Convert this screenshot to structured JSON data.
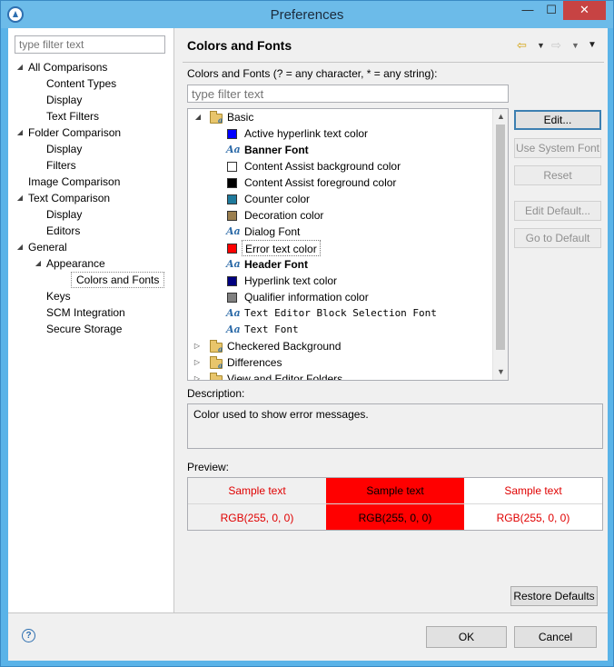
{
  "window": {
    "title": "Preferences"
  },
  "titlebar": {
    "minimize_glyph": "—",
    "maximize_glyph": "☐",
    "close_glyph": "✕"
  },
  "left": {
    "filter_placeholder": "type filter text",
    "tree": [
      {
        "label": "All Comparisons",
        "level": 0,
        "expanded": true
      },
      {
        "label": "Content Types",
        "level": 1
      },
      {
        "label": "Display",
        "level": 1
      },
      {
        "label": "Text Filters",
        "level": 1
      },
      {
        "label": "Folder Comparison",
        "level": 0,
        "expanded": true
      },
      {
        "label": "Display",
        "level": 1
      },
      {
        "label": "Filters",
        "level": 1
      },
      {
        "label": "Image Comparison",
        "level": 0
      },
      {
        "label": "Text Comparison",
        "level": 0,
        "expanded": true
      },
      {
        "label": "Display",
        "level": 1
      },
      {
        "label": "Editors",
        "level": 1
      },
      {
        "label": "General",
        "level": 0,
        "expanded": true
      },
      {
        "label": "Appearance",
        "level": 1,
        "expanded": true
      },
      {
        "label": "Colors and Fonts",
        "level": 2,
        "selected": true
      },
      {
        "label": "Keys",
        "level": 1
      },
      {
        "label": "SCM Integration",
        "level": 1
      },
      {
        "label": "Secure Storage",
        "level": 1
      }
    ]
  },
  "right": {
    "page_title": "Colors and Fonts",
    "nav": {
      "back_glyph": "⇦",
      "dropdown_glyph": "▼",
      "forward_glyph": "⇨",
      "menu_glyph": "▼"
    },
    "filter_label": "Colors and Fonts (? = any character, * = any string):",
    "filter_placeholder": "type filter text",
    "tree": {
      "root": "Basic",
      "items": [
        {
          "label": "Active hyperlink text color",
          "kind": "color",
          "color": "#0000ff"
        },
        {
          "label": "Banner Font",
          "kind": "font",
          "style": "bold"
        },
        {
          "label": "Content Assist background color",
          "kind": "color",
          "color": "#ffffff"
        },
        {
          "label": "Content Assist foreground color",
          "kind": "color",
          "color": "#000000"
        },
        {
          "label": "Counter color",
          "kind": "color",
          "color": "#1f7a9c"
        },
        {
          "label": "Decoration color",
          "kind": "color",
          "color": "#9b7f4f"
        },
        {
          "label": "Dialog Font",
          "kind": "font",
          "style": "normal"
        },
        {
          "label": "Error text color",
          "kind": "color",
          "color": "#ff0000",
          "selected": true
        },
        {
          "label": "Header Font",
          "kind": "font",
          "style": "bold"
        },
        {
          "label": "Hyperlink text color",
          "kind": "color",
          "color": "#000080"
        },
        {
          "label": "Qualifier information color",
          "kind": "color",
          "color": "#808080"
        },
        {
          "label": "Text Editor Block Selection Font",
          "kind": "font",
          "style": "mono"
        },
        {
          "label": "Text Font",
          "kind": "font",
          "style": "mono"
        }
      ],
      "folders": [
        "Checkered Background",
        "Differences",
        "View and Editor Folders"
      ]
    },
    "buttons": {
      "edit": "Edit...",
      "use_system_font": "Use System Font",
      "reset": "Reset",
      "edit_default": "Edit Default...",
      "go_to_default": "Go to Default"
    },
    "description_label": "Description:",
    "description_text": "Color used to show error messages.",
    "preview_label": "Preview:",
    "preview": {
      "sample_text": "Sample text",
      "rgb_text": "RGB(255, 0, 0)"
    },
    "restore_defaults": "Restore Defaults"
  },
  "footer": {
    "help_glyph": "?",
    "ok": "OK",
    "cancel": "Cancel"
  }
}
